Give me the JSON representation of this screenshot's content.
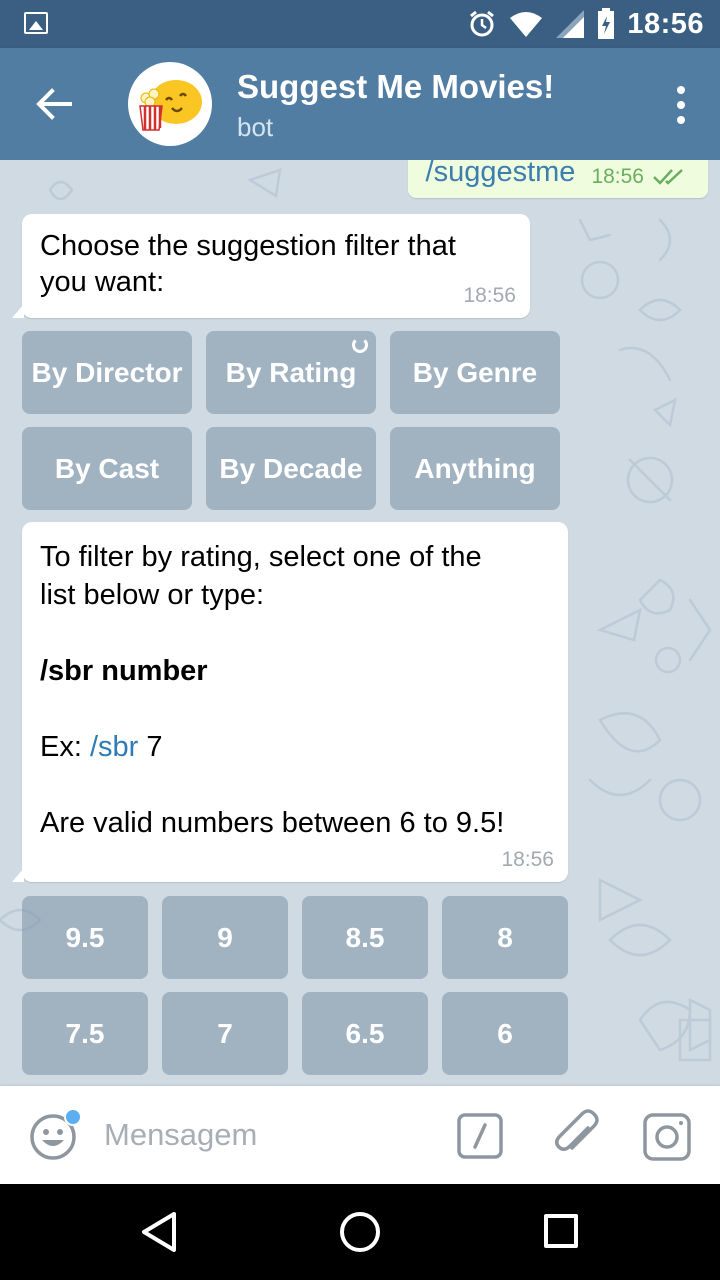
{
  "status_bar": {
    "time": "18:56",
    "icons": [
      "gallery-notification-icon",
      "alarm-icon",
      "wifi-icon",
      "cell-signal-icon",
      "battery-charging-icon"
    ]
  },
  "header": {
    "title": "Suggest Me Movies!",
    "subtitle": "bot",
    "back_icon": "arrow-left-icon",
    "menu_icon": "more-vertical-icon"
  },
  "messages": {
    "outgoing": {
      "text": "/suggestme",
      "time": "18:56",
      "status_icon": "double-check-icon"
    },
    "filter_prompt": {
      "line1": "Choose the suggestion filter that",
      "line2": "you want:",
      "time": "18:56"
    },
    "rating_info": {
      "line1": "To filter by rating, select one of the",
      "line2": "list below or type:",
      "command": "/sbr number",
      "example_prefix": "Ex: ",
      "example_link": "/sbr",
      "example_value": " 7",
      "valid_range": "Are valid numbers between 6 to 9.5!",
      "time": "18:56"
    }
  },
  "filter_keyboard": {
    "row1": [
      "By Director",
      "By Rating",
      "By Genre"
    ],
    "row2": [
      "By Cast",
      "By Decade",
      "Anything"
    ]
  },
  "rating_keyboard": {
    "row1": [
      "9.5",
      "9",
      "8.5",
      "8"
    ],
    "row2": [
      "7.5",
      "7",
      "6.5",
      "6"
    ]
  },
  "input_bar": {
    "placeholder": "Mensagem",
    "icons": [
      "emoji-icon",
      "slash-command-icon",
      "paperclip-icon",
      "camera-icon"
    ]
  },
  "colors": {
    "status_bar": "#3a5f82",
    "header": "#527da3",
    "chat_background": "#cfdae3",
    "outgoing_bubble": "#effdde",
    "link": "#2f7bb6",
    "keyboard_button": "#849aad"
  }
}
